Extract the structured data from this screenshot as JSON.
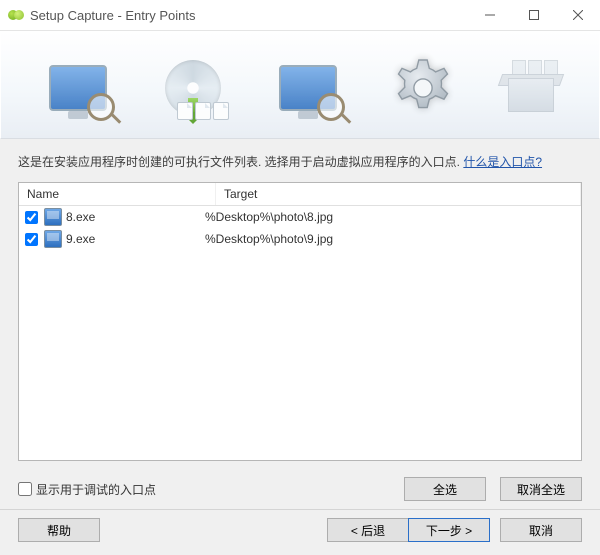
{
  "window": {
    "title": "Setup Capture - Entry Points"
  },
  "description": {
    "text": "这是在安装应用程序时创建的可执行文件列表. 选择用于启动虚拟应用程序的入口点. ",
    "link_text": "什么是入口点?"
  },
  "table": {
    "headers": {
      "name": "Name",
      "target": "Target"
    },
    "rows": [
      {
        "checked": true,
        "name": "8.exe",
        "target": "%Desktop%\\photo\\8.jpg"
      },
      {
        "checked": true,
        "name": "9.exe",
        "target": "%Desktop%\\photo\\9.jpg"
      }
    ]
  },
  "options": {
    "debug_checkbox_label": "显示用于调试的入口点",
    "select_all": "全选",
    "deselect_all": "取消全选"
  },
  "footer": {
    "help": "帮助",
    "back": "< 后退",
    "next": "下一步 >",
    "cancel": "取消"
  }
}
